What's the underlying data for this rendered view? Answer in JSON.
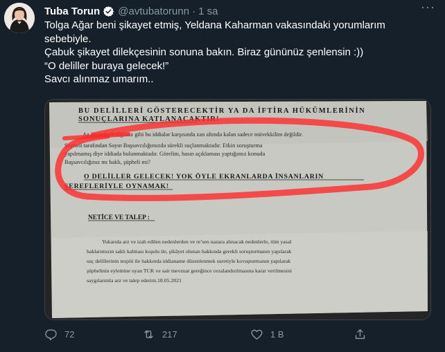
{
  "tweet": {
    "author_name": "Tuba Torun",
    "handle": "@avtubatorunn",
    "separator": "·",
    "time": "1 sa",
    "more": "···",
    "text": "Tolga Ağar beni şikayet etmiş, Yeldana Kaharman vakasındaki yorumlarım sebebiyle.\nÇabuk şikayet dilekçesinin sonuna bakın. Biraz gününüz şenlensin :))\n“O deliller buraya gelecek!”\nSavcı alınmaz umarım.."
  },
  "document": {
    "heading_line1": "BU DELİLLERİ GÖSTERECEKTİR YA DA İFTİRA HÜKÜMLERİNİN",
    "heading_line2": "SONUÇLARINA KATLANACAKTIR!",
    "para_line1": "Az önce de dediğimiz gibi bu iddialar karşısında zan altında kalan sadece müvekkilim değildir.",
    "para_line2": "Şüpheli tarafından Sayın Başsavcılığımızda sürekli suçlanmaktadır. Etkin soruşturma",
    "para_line3": "yapılmamış diye iddiada bulunmaktadır. Görelim, basın açıklaması yaptığımız konuda",
    "para_line4": "Başsavcılığınız mı haklı, şüpheli mi?",
    "caps_line1": "O DELİLLER GELECEK! YOK ÖYLE EKRANLARDA İNSANLARIN",
    "caps_line2": "ŞEREFLERİYLE OYNAMAK!",
    "section_title": "NETİCE VE TALEP :",
    "body_line1": "Yukarıda arz ve izah edilen nedenlerden ve re’sen nazara alınacak nedenlerle, tüm yasal",
    "body_line2": "haklarımızın saklı kalması koşulu ile, şikâyet olunan hakkında gerekli soruşturmanın yapılarak",
    "body_line3": "suç delillerinin tespiti ile hakkında iddianame düzenlenmek suretiyle kovuşturmanın yapılarak",
    "body_line4": "şüphelinin eylemine uyan TCK ve sair mevzuat gereğince cezalandırılmasına karar verilmesini",
    "body_line5": "saygılarımla arz ve talep ederim.18.05.2021"
  },
  "actions": {
    "reply_count": "72",
    "retweet_count": "217",
    "like_count": "1 B",
    "share_count": ""
  },
  "colors": {
    "background": "#15202b",
    "secondary_text": "#8899a6",
    "verified_blue": "#1da1f2",
    "marker_red": "#ff2a2a"
  },
  "icons": [
    "verified-badge-icon",
    "more-options-icon",
    "reply-icon",
    "retweet-icon",
    "like-icon",
    "share-icon"
  ]
}
